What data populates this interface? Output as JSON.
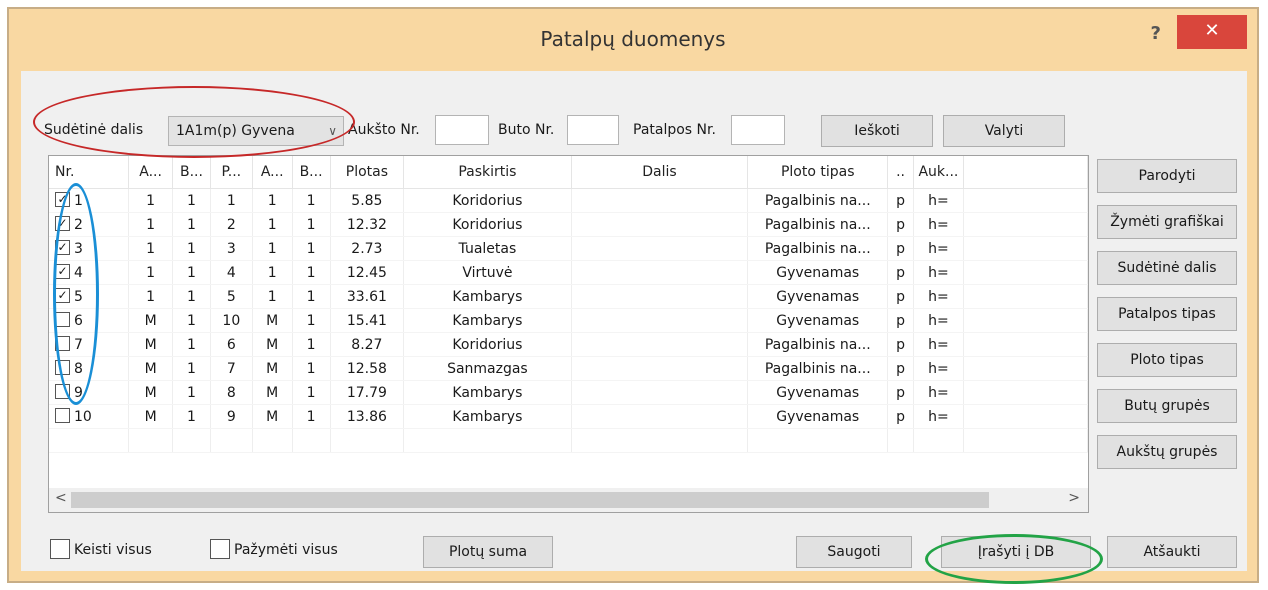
{
  "window": {
    "title": "Patalpų duomenys",
    "help": "?",
    "close": "✕"
  },
  "filters": {
    "sudetine_label": "Sudėtinė dalis",
    "sudetine_value": "1A1m(p) Gyvena",
    "aukstas_label": "Aukšto Nr.",
    "aukstas_value": "",
    "butas_label": "Buto Nr.",
    "butas_value": "",
    "patalpa_label": "Patalpos Nr.",
    "patalpa_value": "",
    "search_button": "Ieškoti",
    "clear_button": "Valyti"
  },
  "table": {
    "headers": [
      "Nr.",
      "A...",
      "B...",
      "P...",
      "A...",
      "B...",
      "Plotas",
      "Paskirtis",
      "Dalis",
      "Ploto tipas",
      "..",
      "Auk..."
    ],
    "rows": [
      {
        "checked": true,
        "cells": [
          "1",
          "1",
          "1",
          "1",
          "1",
          "1",
          "5.85",
          "Koridorius",
          "",
          "Pagalbinis na...",
          "p",
          "h="
        ]
      },
      {
        "checked": true,
        "cells": [
          "2",
          "1",
          "1",
          "2",
          "1",
          "1",
          "12.32",
          "Koridorius",
          "",
          "Pagalbinis na...",
          "p",
          "h="
        ]
      },
      {
        "checked": true,
        "cells": [
          "3",
          "1",
          "1",
          "3",
          "1",
          "1",
          "2.73",
          "Tualetas",
          "",
          "Pagalbinis na...",
          "p",
          "h="
        ]
      },
      {
        "checked": true,
        "cells": [
          "4",
          "1",
          "1",
          "4",
          "1",
          "1",
          "12.45",
          "Virtuvė",
          "",
          "Gyvenamas",
          "p",
          "h="
        ]
      },
      {
        "checked": true,
        "cells": [
          "5",
          "1",
          "1",
          "5",
          "1",
          "1",
          "33.61",
          "Kambarys",
          "",
          "Gyvenamas",
          "p",
          "h="
        ]
      },
      {
        "checked": false,
        "cells": [
          "6",
          "M",
          "1",
          "10",
          "M",
          "1",
          "15.41",
          "Kambarys",
          "",
          "Gyvenamas",
          "p",
          "h="
        ]
      },
      {
        "checked": false,
        "cells": [
          "7",
          "M",
          "1",
          "6",
          "M",
          "1",
          "8.27",
          "Koridorius",
          "",
          "Pagalbinis na...",
          "p",
          "h="
        ]
      },
      {
        "checked": false,
        "cells": [
          "8",
          "M",
          "1",
          "7",
          "M",
          "1",
          "12.58",
          "Sanmazgas",
          "",
          "Pagalbinis na...",
          "p",
          "h="
        ]
      },
      {
        "checked": false,
        "cells": [
          "9",
          "M",
          "1",
          "8",
          "M",
          "1",
          "17.79",
          "Kambarys",
          "",
          "Gyvenamas",
          "p",
          "h="
        ]
      },
      {
        "checked": false,
        "cells": [
          "10",
          "M",
          "1",
          "9",
          "M",
          "1",
          "13.86",
          "Kambarys",
          "",
          "Gyvenamas",
          "p",
          "h="
        ]
      }
    ],
    "scroll_left": "<",
    "scroll_right": ">"
  },
  "side_buttons": [
    "Parodyti",
    "Žymėti grafiškai",
    "Sudėtinė dalis",
    "Patalpos tipas",
    "Ploto tipas",
    "Butų grupės",
    "Aukštų grupės"
  ],
  "bottom": {
    "keisti_visus": "Keisti visus",
    "pazymeti_visus": "Pažymėti visus",
    "plotu_suma": "Plotų suma",
    "saugoti": "Saugoti",
    "irasyti": "Įrašyti į DB",
    "atsaukti": "Atšaukti"
  },
  "colors": {
    "frame": "#f9d8a2",
    "close": "#d9463c",
    "highlight_red": "#c62828",
    "highlight_blue": "#1a8fd6",
    "highlight_green": "#22a346"
  }
}
